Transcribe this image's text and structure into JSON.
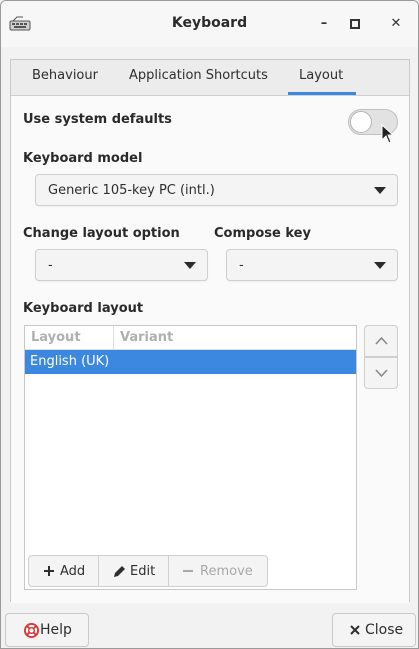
{
  "window": {
    "title": "Keyboard"
  },
  "tabs": [
    {
      "label": "Behaviour"
    },
    {
      "label": "Application Shortcuts"
    },
    {
      "label": "Layout"
    }
  ],
  "layout_tab": {
    "use_system_defaults_label": "Use system defaults",
    "use_system_defaults_on": false,
    "keyboard_model_label": "Keyboard model",
    "keyboard_model_value": "Generic 105-key PC (intl.)",
    "change_layout_option_label": "Change layout option",
    "change_layout_option_value": "-",
    "compose_key_label": "Compose key",
    "compose_key_value": "-",
    "keyboard_layout_label": "Keyboard layout",
    "columns": [
      "Layout",
      "Variant"
    ],
    "rows": [
      {
        "layout": "English (UK)",
        "variant": ""
      }
    ],
    "buttons": {
      "add": "Add",
      "edit": "Edit",
      "remove": "Remove"
    }
  },
  "footer": {
    "help": "Help",
    "close": "Close"
  },
  "colors": {
    "accent": "#3c88e0"
  }
}
